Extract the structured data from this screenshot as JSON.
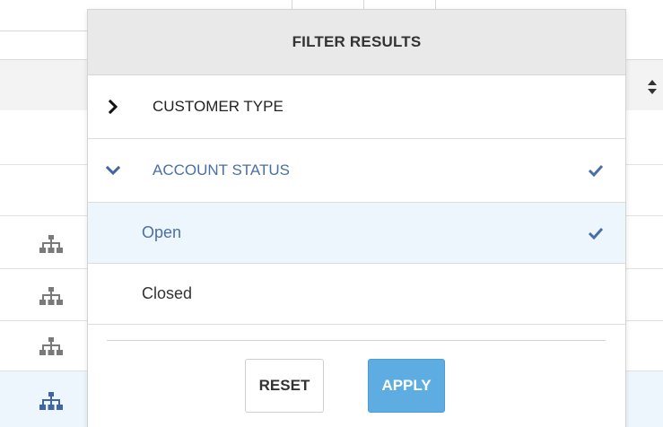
{
  "filter": {
    "title": "FILTER RESULTS",
    "sections": [
      {
        "label": "CUSTOMER TYPE",
        "expanded": false,
        "has_selection": false
      },
      {
        "label": "ACCOUNT STATUS",
        "expanded": true,
        "has_selection": true
      }
    ],
    "options": [
      {
        "label": "Open",
        "selected": true
      },
      {
        "label": "Closed",
        "selected": false
      }
    ],
    "buttons": {
      "reset_label": "RESET",
      "apply_label": "APPLY"
    }
  },
  "table": {
    "header_sort_icon": "sort-icon",
    "row_icon": "hierarchy-icon",
    "rows_with_icon": 4,
    "selected_row_index": 3
  },
  "colors": {
    "accent_text": "#4a6fa5",
    "apply_button": "#5dade2",
    "selected_row_bg": "#eef6fd",
    "header_bg": "#e9e9e9",
    "tree_icon_default": "#7a7a7a",
    "tree_icon_selected": "#3f65a8"
  }
}
